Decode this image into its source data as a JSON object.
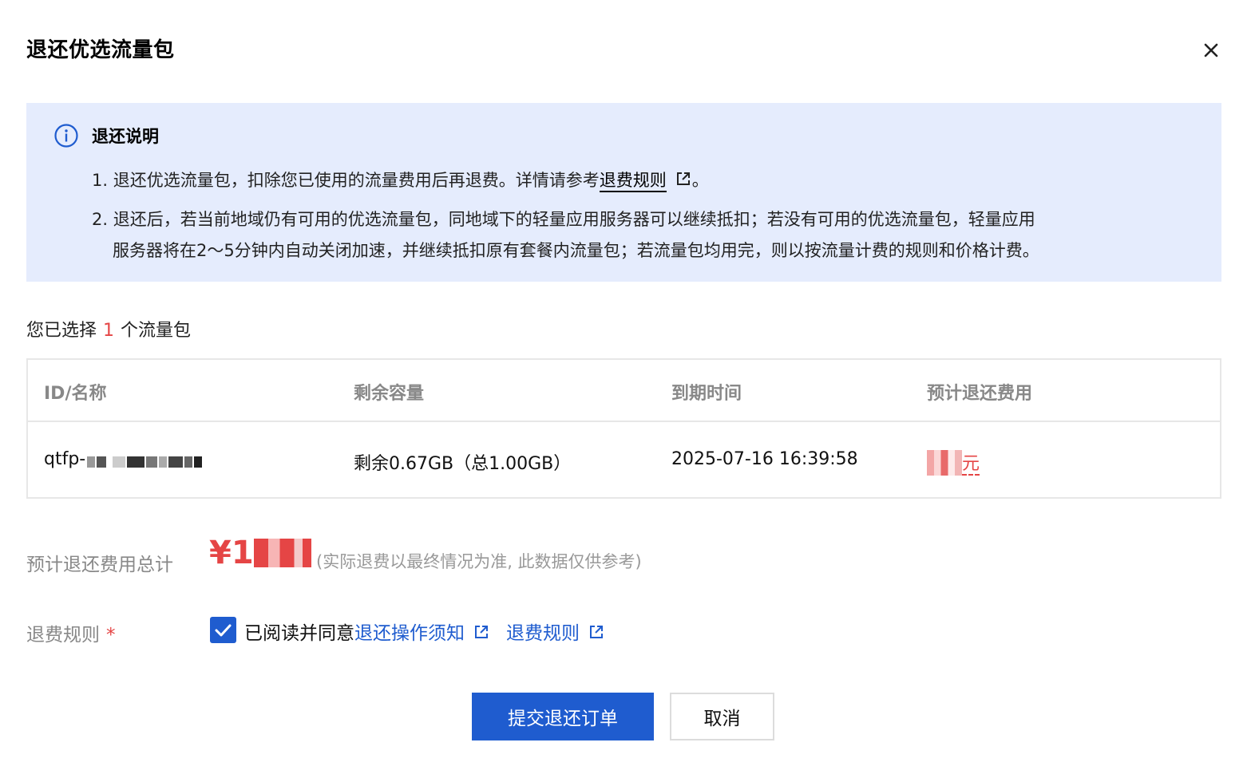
{
  "dialog": {
    "title": "退还优选流量包",
    "close_icon": "close-icon"
  },
  "notice": {
    "icon": "info-icon",
    "title": "退还说明",
    "line1_prefix": "1. 退还优选流量包，扣除您已使用的流量费用后再退费。详情请参考",
    "line1_link": "退费规则",
    "line1_suffix": "。",
    "line2a": "2. 退还后，若当前地域仍有可用的优选流量包，同地域下的轻量应用服务器可以继续抵扣；若没有可用的优选流量包，轻量应用",
    "line2b": "服务器将在2～5分钟内自动关闭加速，并继续抵扣原有套餐内流量包；若流量包均用完，则以按流量计费的规则和价格计费。"
  },
  "selection": {
    "prefix": "您已选择",
    "count": "1",
    "suffix": "个流量包"
  },
  "table": {
    "headers": [
      "ID/名称",
      "剩余容量",
      "到期时间",
      "预计退还费用"
    ],
    "rows": [
      {
        "id_prefix": "qtfp-",
        "remaining": "剩余0.67GB（总1.00GB）",
        "expire": "2025-07-16 16:39:58",
        "refund_unit": "元"
      }
    ]
  },
  "total": {
    "label": "预计退还费用总计",
    "currency": "¥1",
    "note": "(实际退费以最终情况为准, 此数据仅供参考)"
  },
  "rules": {
    "label": "退费规则",
    "required_mark": "*",
    "checked": true,
    "agree_prefix": "已阅读并同意",
    "link1": "退还操作须知",
    "link2": "退费规则"
  },
  "actions": {
    "submit": "提交退还订单",
    "cancel": "取消"
  },
  "colors": {
    "primary": "#1f5ccf",
    "danger": "#e54545",
    "notice_bg": "#e5ecfd"
  }
}
